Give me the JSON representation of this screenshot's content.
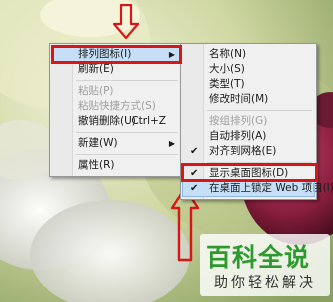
{
  "context_menu": {
    "items": [
      {
        "label": "排列图标(I)",
        "submenu": true,
        "highlighted": true
      },
      {
        "label": "刷新(E)"
      },
      {
        "separator": true
      },
      {
        "label": "粘贴(P)",
        "disabled": true
      },
      {
        "label": "粘贴快捷方式(S)",
        "disabled": true
      },
      {
        "label": "撤销删除(U)",
        "shortcut": "Ctrl+Z"
      },
      {
        "separator": true
      },
      {
        "label": "新建(W)",
        "submenu": true
      },
      {
        "separator": true
      },
      {
        "label": "属性(R)"
      }
    ]
  },
  "submenu": {
    "items": [
      {
        "label": "名称(N)"
      },
      {
        "label": "大小(S)"
      },
      {
        "label": "类型(T)"
      },
      {
        "label": "修改时间(M)"
      },
      {
        "separator": true
      },
      {
        "label": "按组排列(G)",
        "disabled": true
      },
      {
        "label": "自动排列(A)"
      },
      {
        "label": "对齐到网格(E)",
        "checked": true
      },
      {
        "separator": true
      },
      {
        "label": "显示桌面图标(D)",
        "checked": true
      },
      {
        "label": "在桌面上锁定 Web 项目(I)",
        "checked": true,
        "highlighted": true
      }
    ]
  },
  "check_glyph": "✔",
  "arrow_glyph": "▶",
  "watermark": {
    "title": "百科全说",
    "subtitle": "助你轻松解决"
  },
  "annotation_color": "#d81616"
}
